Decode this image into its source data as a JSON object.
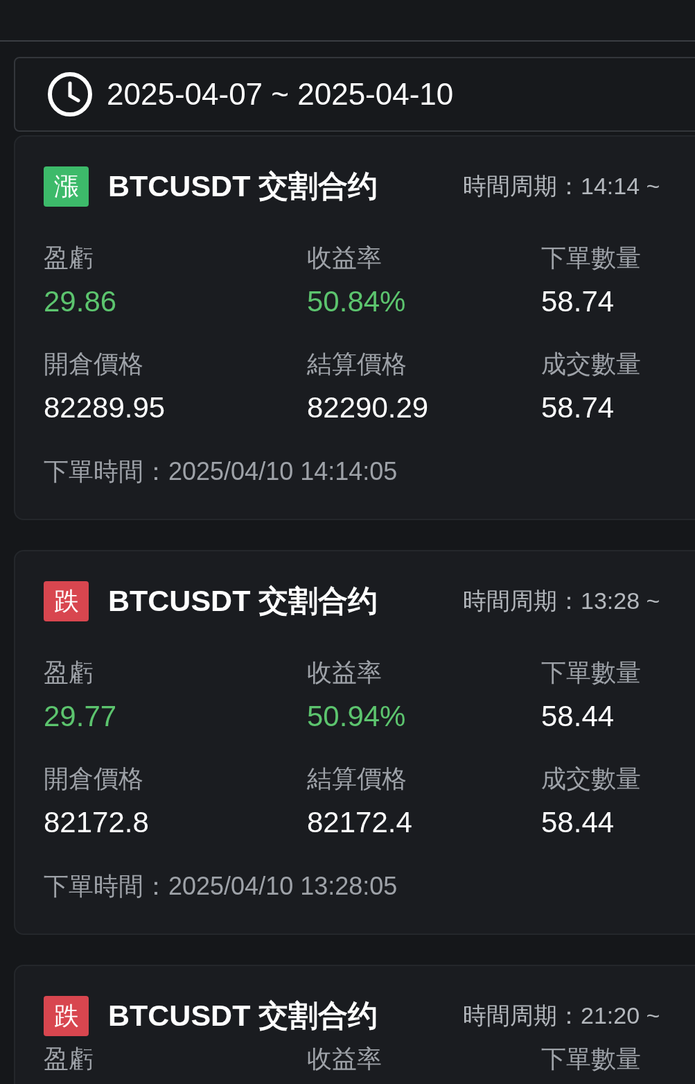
{
  "date_range": {
    "text": "2025-04-07 ~ 2025-04-10"
  },
  "orders": [
    {
      "badge": {
        "text": "漲",
        "color": "#3dba6a"
      },
      "title": "BTCUSDT 交割合约",
      "period": "時間周期：14:14 ~",
      "metrics": [
        {
          "label": "盈虧",
          "value": "29.86",
          "kind": "positive"
        },
        {
          "label": "收益率",
          "value": "50.84%",
          "kind": "positive"
        },
        {
          "label": "下單數量",
          "value": "58.74",
          "kind": "plain"
        },
        {
          "label": "開倉價格",
          "value": "82289.95",
          "kind": "plain"
        },
        {
          "label": "結算價格",
          "value": "82290.29",
          "kind": "plain"
        },
        {
          "label": "成交數量",
          "value": "58.74",
          "kind": "plain"
        }
      ],
      "order_time": "下單時間：2025/04/10 14:14:05"
    },
    {
      "badge": {
        "text": "跌",
        "color": "#d8464f"
      },
      "title": "BTCUSDT 交割合约",
      "period": "時間周期：13:28 ~",
      "metrics": [
        {
          "label": "盈虧",
          "value": "29.77",
          "kind": "positive"
        },
        {
          "label": "收益率",
          "value": "50.94%",
          "kind": "positive"
        },
        {
          "label": "下單數量",
          "value": "58.44",
          "kind": "plain"
        },
        {
          "label": "開倉價格",
          "value": "82172.8",
          "kind": "plain"
        },
        {
          "label": "結算價格",
          "value": "82172.4",
          "kind": "plain"
        },
        {
          "label": "成交數量",
          "value": "58.44",
          "kind": "plain"
        }
      ],
      "order_time": "下單時間：2025/04/10 13:28:05"
    },
    {
      "badge": {
        "text": "跌",
        "color": "#d8464f"
      },
      "title": "BTCUSDT 交割合约",
      "period": "時間周期：21:20 ~",
      "metrics": [
        {
          "label": "盈虧"
        },
        {
          "label": "收益率"
        },
        {
          "label": "下單數量"
        }
      ]
    }
  ]
}
